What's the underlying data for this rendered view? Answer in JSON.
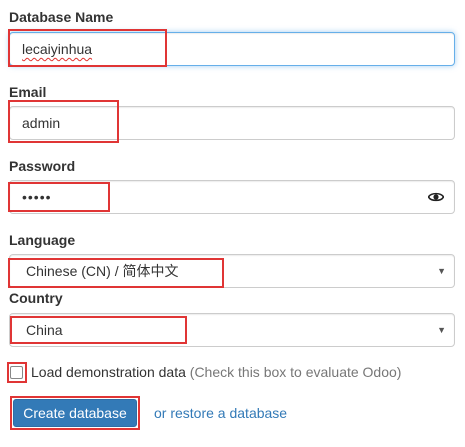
{
  "form": {
    "db_name": {
      "label": "Database Name",
      "value": "lecaiyinhua"
    },
    "email": {
      "label": "Email",
      "value": "admin"
    },
    "password": {
      "label": "Password",
      "value": "•••••",
      "toggle_icon": "eye-icon"
    },
    "language": {
      "label": "Language",
      "selected": "Chinese (CN) / 简体中文",
      "icon": "chevron-down-icon"
    },
    "country": {
      "label": "Country",
      "selected": "China",
      "icon": "chevron-down-icon"
    },
    "demo_data": {
      "label": "Load demonstration data",
      "hint": "(Check this box to evaluate Odoo)",
      "checked": false
    },
    "create_button": "Create database",
    "restore_link": "or restore a database"
  },
  "colors": {
    "primary": "#337ab7",
    "highlight": "#e03535",
    "focus": "#66afe9"
  }
}
